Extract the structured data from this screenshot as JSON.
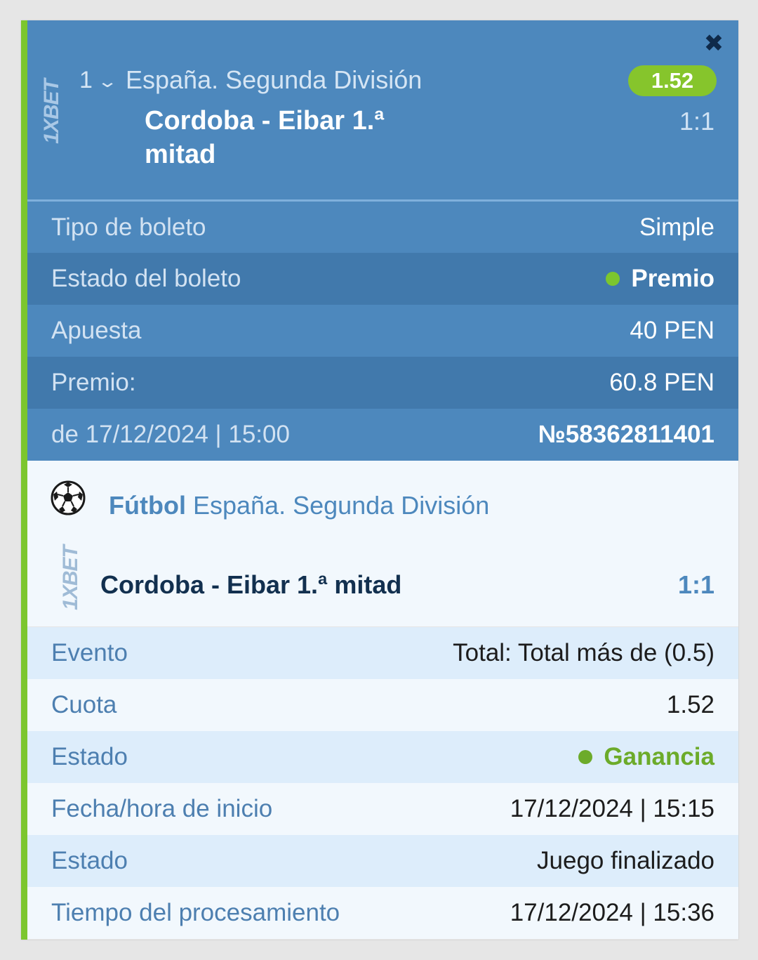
{
  "header": {
    "logo_text": "1XBET",
    "close_glyph": "✖",
    "bet_count": "1",
    "league": "España. Segunda División",
    "odds": "1.52",
    "match_title": "Cordoba - Eibar 1.ª mitad",
    "score": "1:1"
  },
  "summary": [
    {
      "label": "Tipo de boleto",
      "value": "Simple"
    },
    {
      "label": "Estado del boleto",
      "value": "Premio",
      "status_color": "#7cc62e"
    },
    {
      "label": "Apuesta",
      "value": "40 PEN"
    },
    {
      "label": "Premio:",
      "value": "60.8 PEN"
    },
    {
      "label": "de 17/12/2024 | 15:00",
      "value": "№58362811401"
    }
  ],
  "detail": {
    "sport": "Fútbol",
    "league": "España. Segunda División",
    "logo_text": "1XBET",
    "match": "Cordoba - Eibar 1.ª mitad",
    "score": "1:1",
    "rows": [
      {
        "label": "Evento",
        "value": "Total: Total más de (0.5)"
      },
      {
        "label": "Cuota",
        "value": "1.52"
      },
      {
        "label": "Estado",
        "value": "Ganancia",
        "status_color": "#6cab2a"
      },
      {
        "label": "Fecha/hora de inicio",
        "value": "17/12/2024 | 15:15"
      },
      {
        "label": "Estado",
        "value": "Juego finalizado"
      },
      {
        "label": "Tiempo del procesamiento",
        "value": "17/12/2024 | 15:36"
      }
    ]
  },
  "colors": {
    "accent": "#7cc62e",
    "header_bg": "#4d88bd",
    "row_dark": "#4179ac"
  },
  "icons": [
    "close-icon",
    "chevron-down-icon",
    "soccer-ball-icon"
  ]
}
